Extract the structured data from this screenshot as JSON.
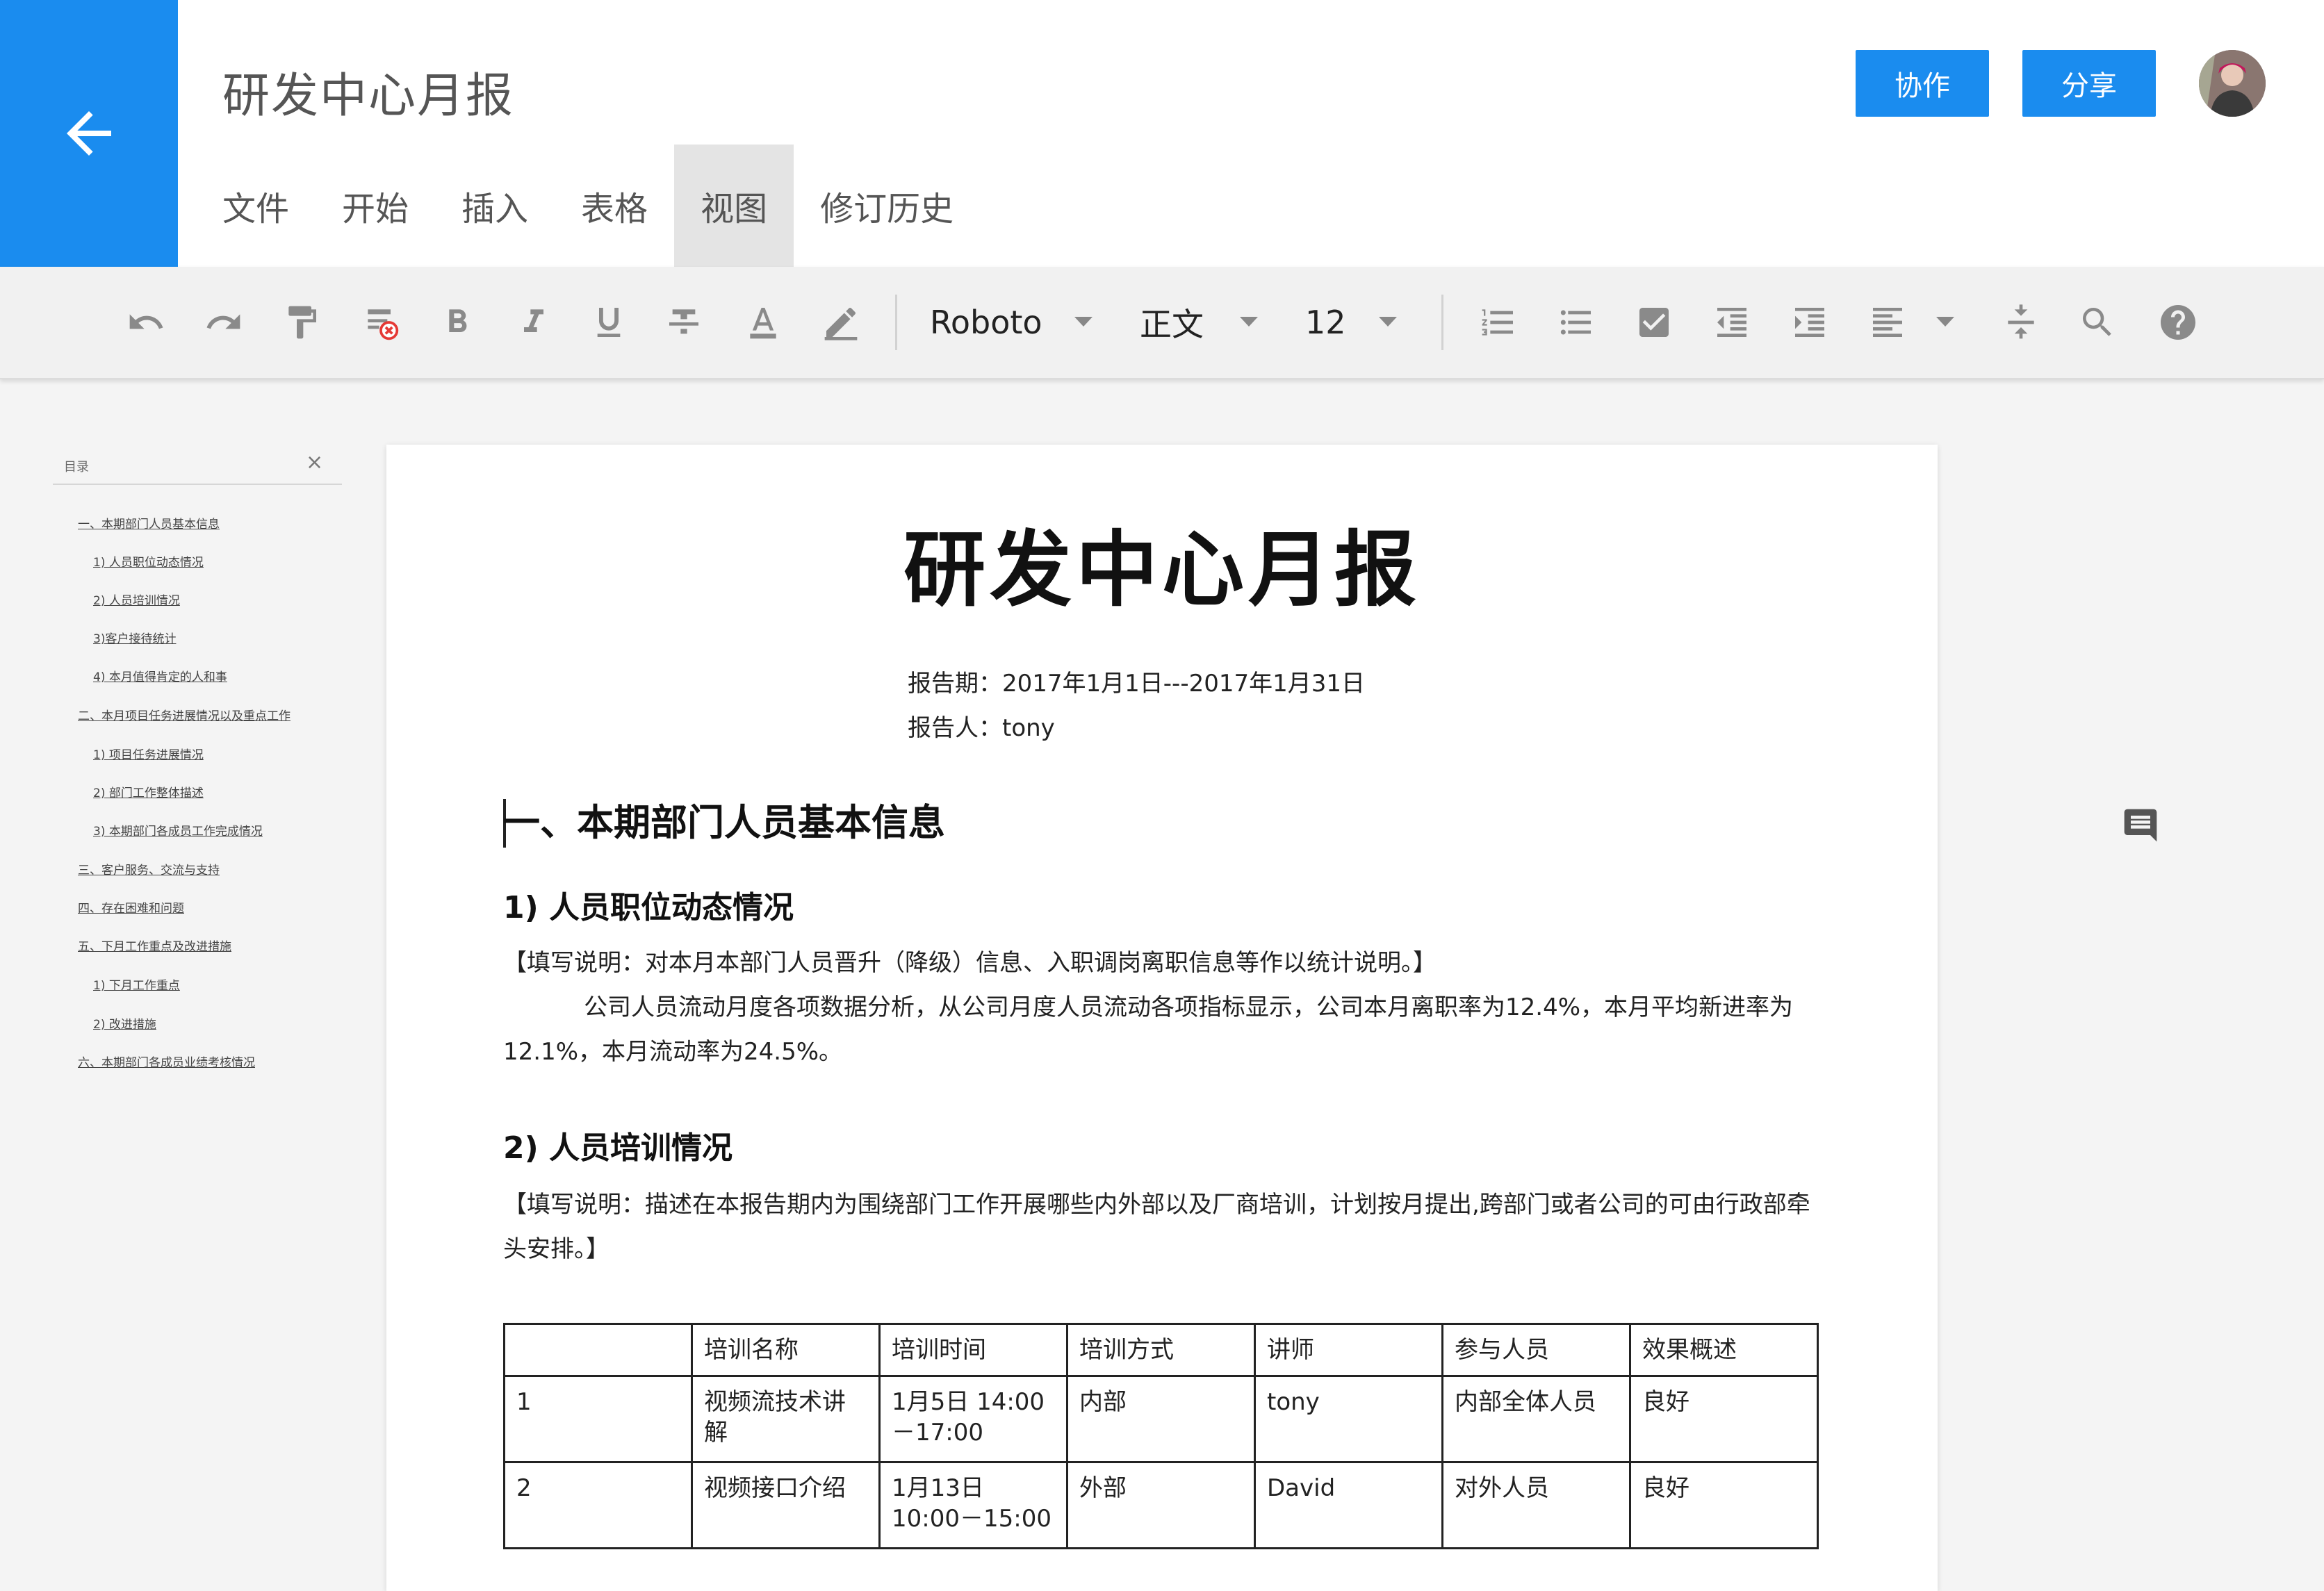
{
  "header": {
    "doc_title": "研发中心月报",
    "menu": [
      "文件",
      "开始",
      "插入",
      "表格",
      "视图",
      "修订历史"
    ],
    "active_menu": "视图",
    "collab_label": "协作",
    "share_label": "分享"
  },
  "toolbar": {
    "icons": [
      "undo-icon",
      "redo-icon",
      "format-painter-icon",
      "clear-format-icon",
      "bold-icon",
      "italic-icon",
      "underline-icon",
      "strikethrough-icon",
      "text-color-icon",
      "highlight-icon"
    ],
    "font": "Roboto",
    "style": "正文",
    "size": "12",
    "right_icons": [
      "ordered-list-icon",
      "bullet-list-icon",
      "checkbox-icon",
      "outdent-icon",
      "indent-icon",
      "align-icon",
      "line-spacing-icon",
      "search-icon",
      "help-icon"
    ],
    "accent": "#1a8cef"
  },
  "outline": {
    "title": "目录",
    "close": "×",
    "items": [
      "一、本期部门人员基本信息",
      "1) 人员职位动态情况",
      "2) 人员培训情况",
      "3)客户接待统计",
      "4) 本月值得肯定的人和事",
      "二、本月项目任务进展情况以及重点工作",
      "1) 项目任务进展情况",
      "2) 部门工作整体描述",
      "3) 本期部门各成员工作完成情况",
      "三、客户服务、交流与支持",
      "四、存在困难和问题",
      "五、下月工作重点及改进措施",
      "1) 下月工作重点",
      "2) 改进措施",
      "六、本期部门各成员业绩考核情况"
    ]
  },
  "document": {
    "title": "研发中心月报",
    "period": "报告期：2017年1月1日---2017年1月31日",
    "reporter": "报告人：tony",
    "section1": "一、本期部门人员基本信息",
    "sub1": "1) 人员职位动态情况",
    "note1": "【填写说明：对本月本部门人员晋升（降级）信息、入职调岗离职信息等作以统计说明。】",
    "para1": "公司人员流动月度各项数据分析，从公司月度人员流动各项指标显示，公司本月离职率为12.4%，本月平均新进率为12.1%，本月流动率为24.5%。",
    "sub2": "2) 人员培训情况",
    "note2": "【填写说明：描述在本报告期内为围绕部门工作开展哪些内外部以及厂商培训，计划按月提出,跨部门或者公司的可由行政部牵头安排。】",
    "table": {
      "headers": [
        "",
        "培训名称",
        "培训时间",
        "培训方式",
        "讲师",
        "参与人员",
        "效果概述"
      ],
      "rows": [
        [
          "1",
          "视频流技术讲解",
          "1月5日 14:00－17:00",
          "内部",
          "tony",
          "内部全体人员",
          "良好"
        ],
        [
          "2",
          "视频接口介绍",
          "1月13日 10:00－15:00",
          "外部",
          "David",
          "对外人员",
          "良好"
        ]
      ]
    }
  }
}
